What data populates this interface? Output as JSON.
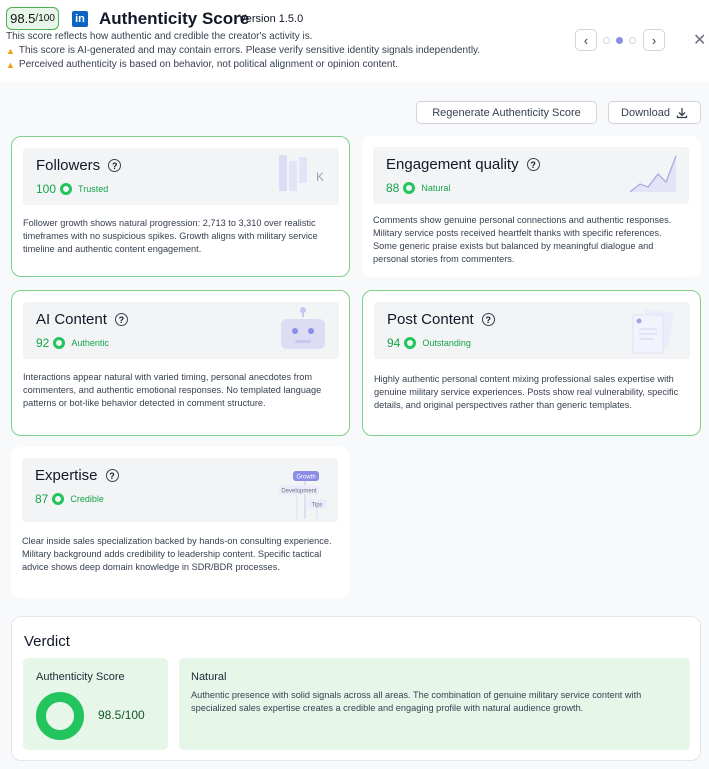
{
  "header": {
    "score_value": "98.5",
    "score_suffix": "/100",
    "title": "Authenticity Score",
    "version": "Version 1.5.0",
    "description": "This score reflects how authentic and credible the creator's activity is.",
    "warnings": [
      "This score is AI-generated and may contain errors. Please verify sensitive identity signals independently.",
      "Perceived authenticity is based on behavior, not political alignment or opinion content."
    ],
    "brand_logo_text": "in",
    "pager": {
      "prev_icon": "chevron-left-icon",
      "next_icon": "chevron-right-icon",
      "active_index": 1,
      "count": 3
    },
    "close_icon": "close-icon"
  },
  "actions": {
    "regenerate_label": "Regenerate Authenticity Score",
    "download_label": "Download"
  },
  "cards": {
    "followers": {
      "title": "Followers",
      "score": "100",
      "label": "Trusted",
      "illustration_text": "K",
      "body": "Follower growth shows natural progression: 2,713 to 3,310 over realistic timeframes with no suspicious spikes. Growth aligns with military service timeline and authentic content engagement."
    },
    "engagement": {
      "title": "Engagement quality",
      "score": "88",
      "label": "Natural",
      "body": "Comments show genuine personal connections and authentic responses. Military service posts received heartfelt thanks with specific references. Some generic praise exists but balanced by meaningful dialogue and personal stories from commenters."
    },
    "ai_content": {
      "title": "AI Content",
      "score": "92",
      "label": "Authentic",
      "body": "Interactions appear natural with varied timing, personal anecdotes from commenters, and authentic emotional responses. No templated language patterns or bot-like behavior detected in comment structure."
    },
    "post_content": {
      "title": "Post Content",
      "score": "94",
      "label": "Outstanding",
      "body": "Highly authentic personal content mixing professional sales expertise with genuine military service experiences. Posts show real vulnerability, specific details, and original perspectives rather than generic templates."
    },
    "expertise": {
      "title": "Expertise",
      "score": "87",
      "label": "Credible",
      "illustration_tags": [
        "Growth",
        "Development",
        "Tips"
      ],
      "body": "Clear inside sales specialization backed by hands-on consulting experience. Military background adds credibility to leadership content. Specific tactical advice shows deep domain knowledge in SDR/BDR processes."
    }
  },
  "verdict": {
    "title": "Verdict",
    "score_label": "Authenticity Score",
    "score_value": "98.5/100",
    "score_fraction": 0.985,
    "category": "Natural",
    "summary": "Authentic presence with solid signals across all areas. The combination of genuine military service content with specialized sales expertise creates a credible and engaging profile with natural audience growth."
  },
  "colors": {
    "accent_green": "#22c55e",
    "card_border_green": "#7fd18b",
    "pager_active": "#8b8be8",
    "linkedin_blue": "#0a66c2",
    "warning": "#f59e0b"
  }
}
